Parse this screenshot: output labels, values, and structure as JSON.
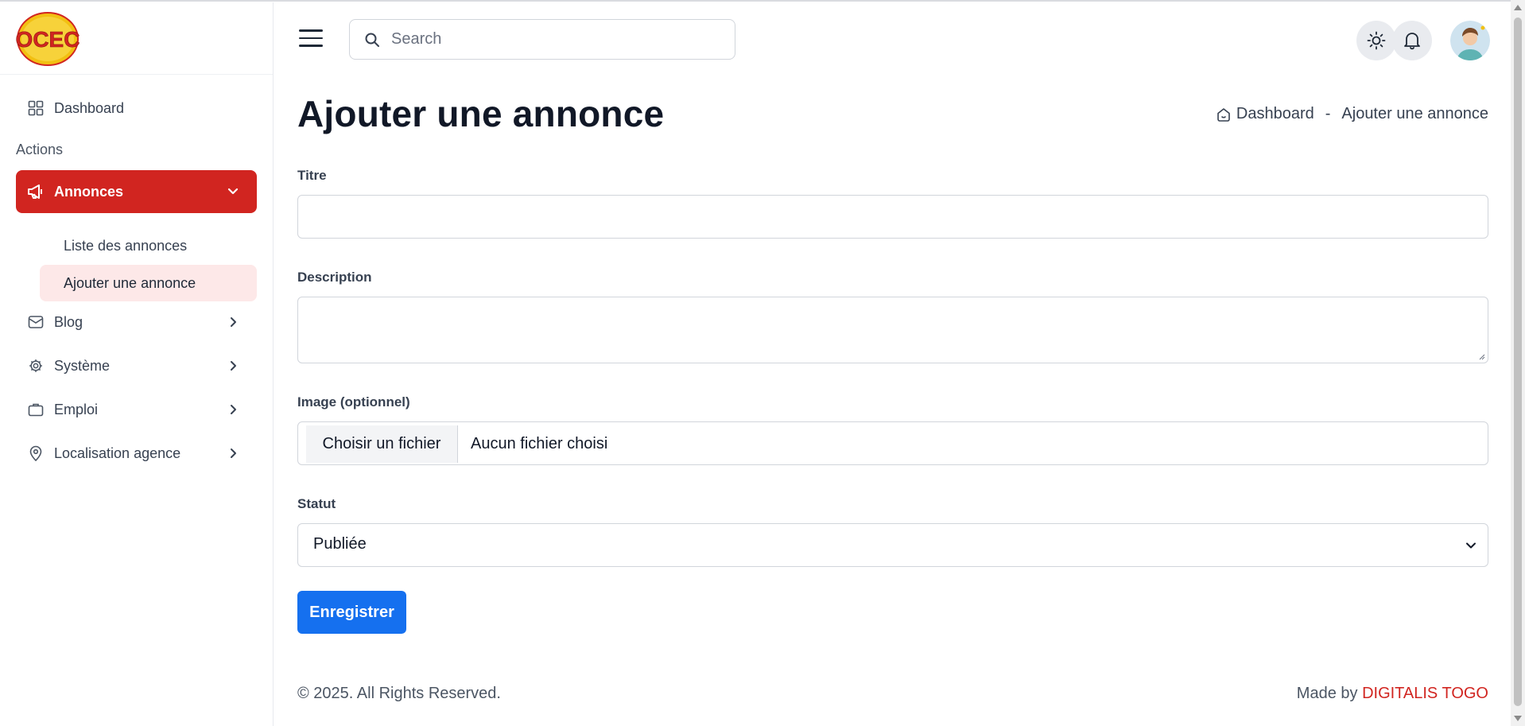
{
  "sidebar": {
    "logo_text": "OCEC",
    "dashboard": "Dashboard",
    "section_label": "Actions",
    "annonces": "Annonces",
    "sub_items": [
      "Liste des annonces",
      "Ajouter une annonce"
    ],
    "blog": "Blog",
    "systeme": "Système",
    "emploi": "Emploi",
    "localisation": "Localisation agence"
  },
  "header": {
    "search_placeholder": "Search"
  },
  "page": {
    "title": "Ajouter une annonce",
    "breadcrumb": [
      "Dashboard",
      "-",
      "Ajouter une annonce"
    ]
  },
  "form": {
    "titre_label": "Titre",
    "titre_value": "",
    "description_label": "Description",
    "description_value": "",
    "image_label": "Image (optionnel)",
    "file_button": "Choisir un fichier",
    "file_status": "Aucun fichier choisi",
    "statut_label": "Statut",
    "statut_value": "Publiée",
    "submit_label": "Enregistrer"
  },
  "footer": {
    "copyright": "© 2025. All Rights Reserved.",
    "made_by": "Made by",
    "brand": "DIGITALIS TOGO"
  },
  "colors": {
    "accent": "#d12520",
    "primary_button": "#1570ef",
    "active_subitem_bg": "#fde8e8"
  },
  "icons": [
    "grid-icon",
    "megaphone-icon",
    "chevron-down-icon",
    "mail-icon",
    "gear-icon",
    "briefcase-icon",
    "map-pin-icon",
    "chevron-right-icon",
    "search-icon",
    "sun-icon",
    "bell-icon",
    "home-icon"
  ]
}
